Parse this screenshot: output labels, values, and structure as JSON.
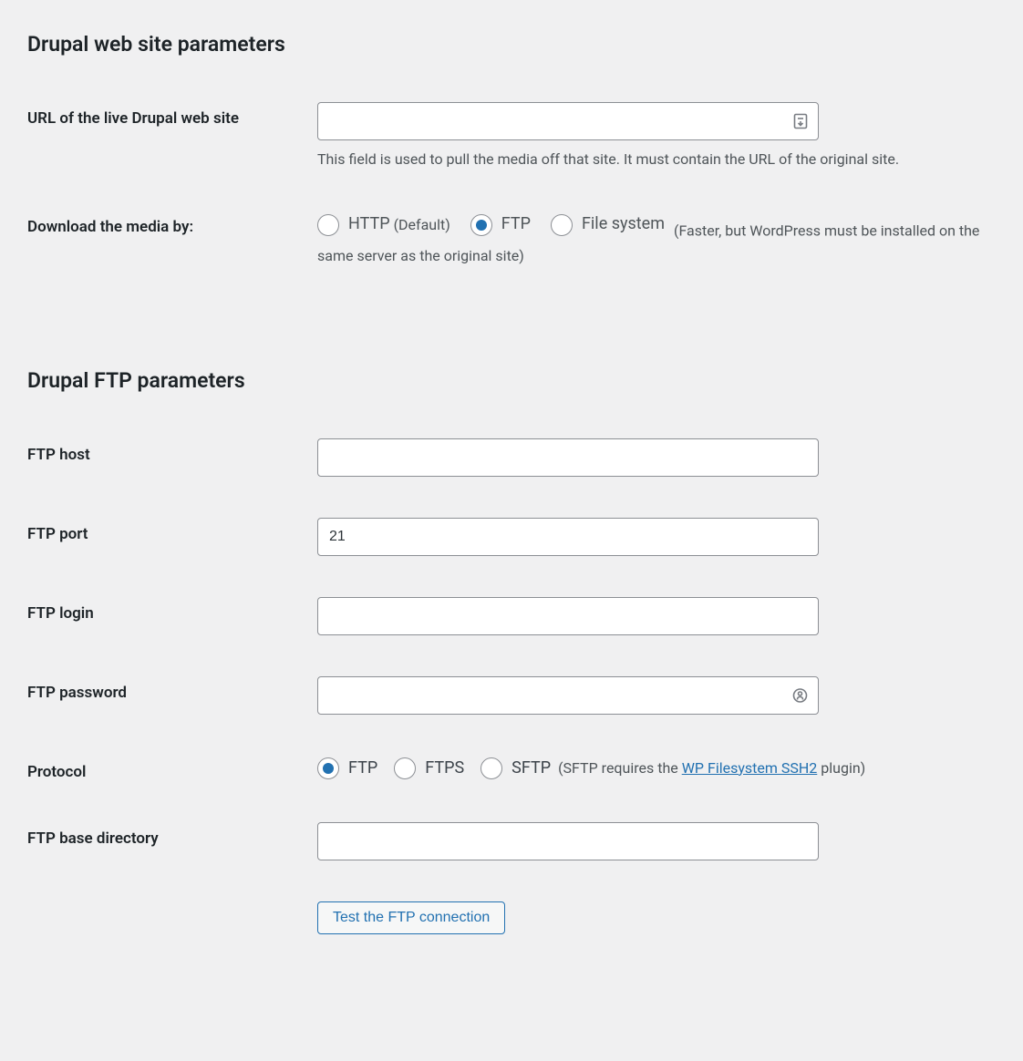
{
  "section1": {
    "heading": "Drupal web site parameters",
    "url_field": {
      "label": "URL of the live Drupal web site",
      "value": "",
      "description": "This field is used to pull the media off that site. It must contain the URL of the original site."
    },
    "download_media": {
      "label": "Download the media by:",
      "options": {
        "http": {
          "label": "HTTP",
          "suffix": "(Default)",
          "checked": false
        },
        "ftp": {
          "label": "FTP",
          "checked": true
        },
        "fs": {
          "label": "File system",
          "suffix_prefix": "(Faster, but WordPress must be installed on the same server as the original site)",
          "checked": false
        }
      }
    }
  },
  "section2": {
    "heading": "Drupal FTP parameters",
    "ftp_host": {
      "label": "FTP host",
      "value": ""
    },
    "ftp_port": {
      "label": "FTP port",
      "value": "21"
    },
    "ftp_login": {
      "label": "FTP login",
      "value": ""
    },
    "ftp_password": {
      "label": "FTP password",
      "value": ""
    },
    "protocol": {
      "label": "Protocol",
      "options": {
        "ftp": {
          "label": "FTP",
          "checked": true
        },
        "ftps": {
          "label": "FTPS",
          "checked": false
        },
        "sftp": {
          "label": "SFTP",
          "checked": false
        }
      },
      "note_prefix": "(SFTP requires the ",
      "note_link": "WP Filesystem SSH2",
      "note_suffix": " plugin)"
    },
    "ftp_base_dir": {
      "label": "FTP base directory",
      "value": ""
    },
    "test_button": "Test the FTP connection"
  }
}
